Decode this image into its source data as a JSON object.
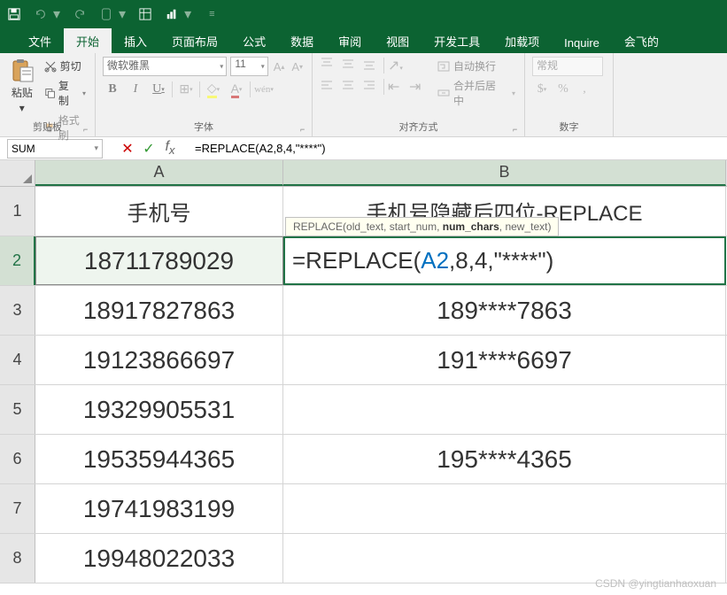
{
  "titlebar": {
    "icons": [
      "save",
      "undo",
      "redo",
      "touch",
      "table",
      "chart"
    ]
  },
  "tabs": {
    "file": "文件",
    "home": "开始",
    "insert": "插入",
    "layout": "页面布局",
    "formulas": "公式",
    "data": "数据",
    "review": "审阅",
    "view": "视图",
    "dev": "开发工具",
    "addins": "加载项",
    "inquire": "Inquire",
    "custom": "会飞的"
  },
  "ribbon": {
    "clipboard": {
      "paste": "粘贴",
      "cut": "剪切",
      "copy": "复制",
      "format_painter": "格式刷",
      "label": "剪贴板"
    },
    "font": {
      "name": "微软雅黑",
      "size": "11",
      "label": "字体"
    },
    "alignment": {
      "wrap": "自动换行",
      "merge": "合并后居中",
      "label": "对齐方式"
    },
    "number": {
      "format": "常规",
      "label": "数字"
    }
  },
  "namebox": "SUM",
  "formula_bar": "=REPLACE(A2,8,4,\"****\")",
  "tooltip": {
    "fn": "REPLACE",
    "args": "(old_text, start_num, ",
    "bold_arg": "num_chars",
    "rest": ", new_text)"
  },
  "columns": [
    "A",
    "B"
  ],
  "row_headers": [
    "1",
    "2",
    "3",
    "4",
    "5",
    "6",
    "7",
    "8"
  ],
  "headers": {
    "a": "手机号",
    "b": "手机号隐藏后四位-REPLACE"
  },
  "data_rows": [
    {
      "a": "18711789029",
      "b_formula": "=REPLACE(A2,8,4,\"****\")",
      "editing": true
    },
    {
      "a": "18917827863",
      "b": "189****7863"
    },
    {
      "a": "19123866697",
      "b": "191****6697"
    },
    {
      "a": "19329905531",
      "b": ""
    },
    {
      "a": "19535944365",
      "b": "195****4365"
    },
    {
      "a": "19741983199",
      "b": ""
    },
    {
      "a": "19948022033",
      "b": ""
    }
  ],
  "watermark": "CSDN @yingtianhaoxuan"
}
